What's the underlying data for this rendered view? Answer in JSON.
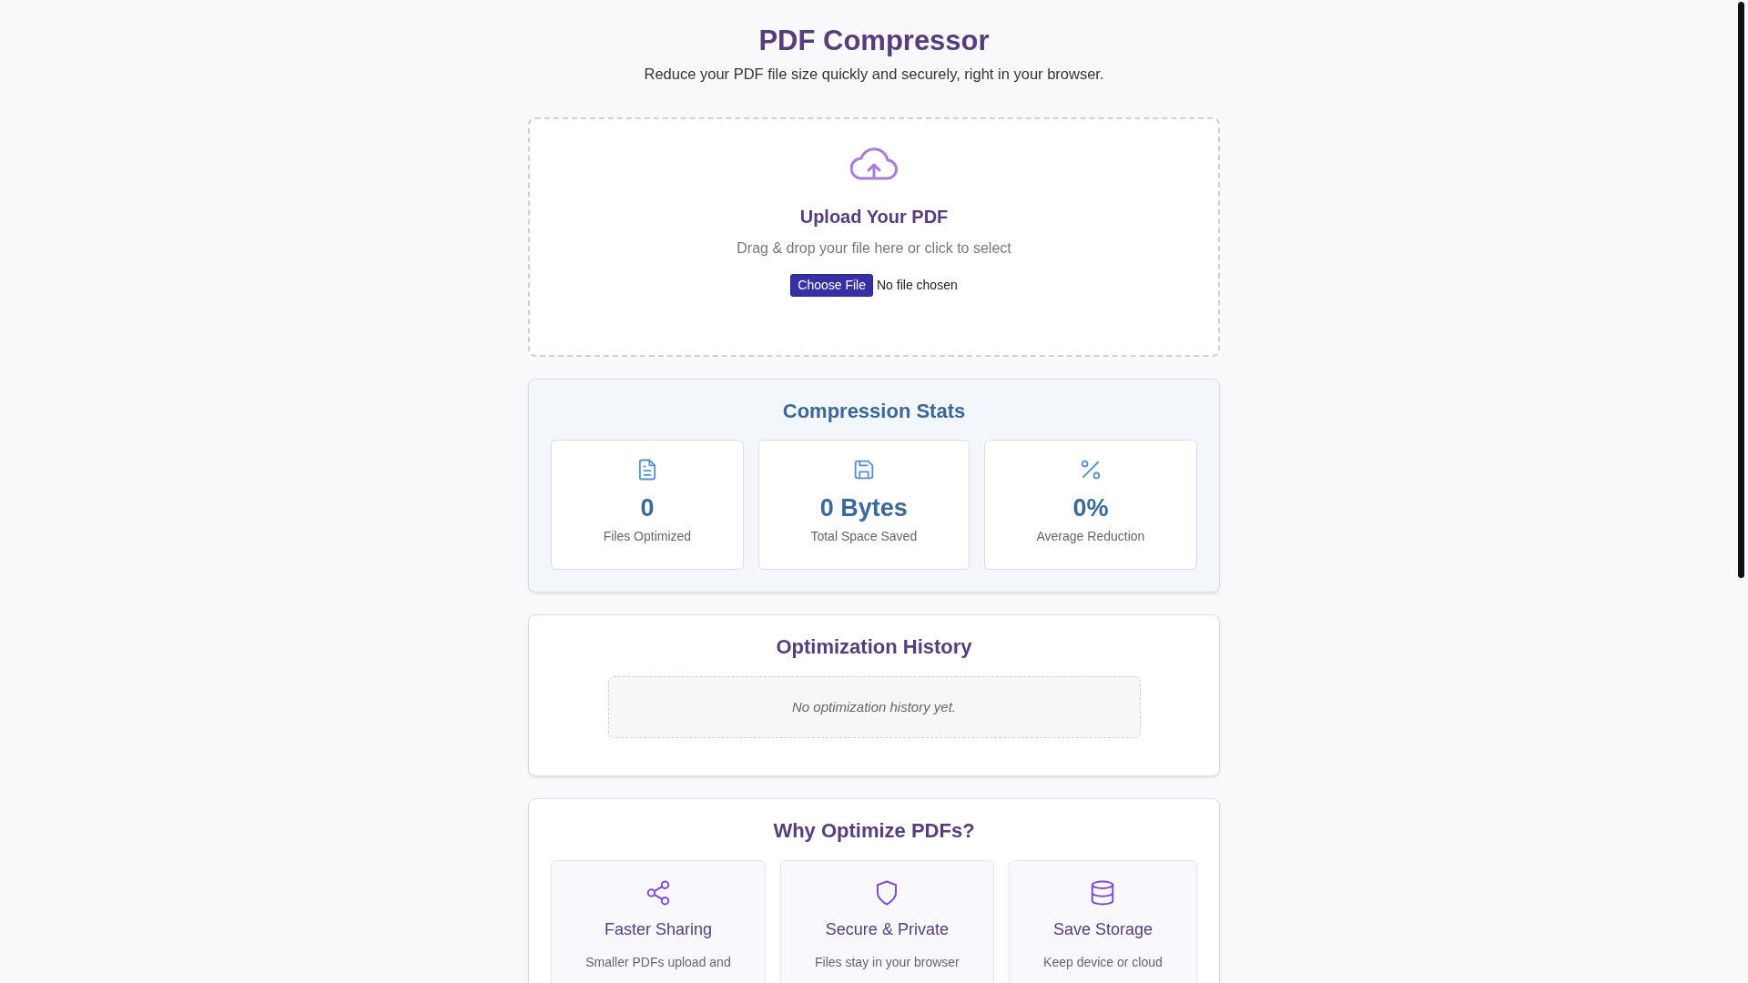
{
  "header": {
    "title": "PDF Compressor",
    "subtitle": "Reduce your PDF file size quickly and securely, right in your browser."
  },
  "upload": {
    "title": "Upload Your PDF",
    "hint": "Drag & drop your file here or click to select",
    "button": "Choose File",
    "file_status": "No file chosen"
  },
  "stats": {
    "title": "Compression Stats",
    "items": [
      {
        "kind": "document",
        "value": "0",
        "label": "Files Optimized"
      },
      {
        "kind": "save",
        "value": "0 Bytes",
        "label": "Total Space Saved"
      },
      {
        "kind": "percent",
        "value": "0%",
        "label": "Average Reduction"
      }
    ]
  },
  "history": {
    "title": "Optimization History",
    "empty_message": "No optimization history yet."
  },
  "benefits": {
    "title": "Why Optimize PDFs?",
    "items": [
      {
        "kind": "share",
        "title": "Faster Sharing",
        "description": "Smaller PDFs upload and"
      },
      {
        "kind": "shield",
        "title": "Secure & Private",
        "description": "Files stay in your browser"
      },
      {
        "kind": "database",
        "title": "Save Storage",
        "description": "Keep device or cloud"
      }
    ]
  }
}
